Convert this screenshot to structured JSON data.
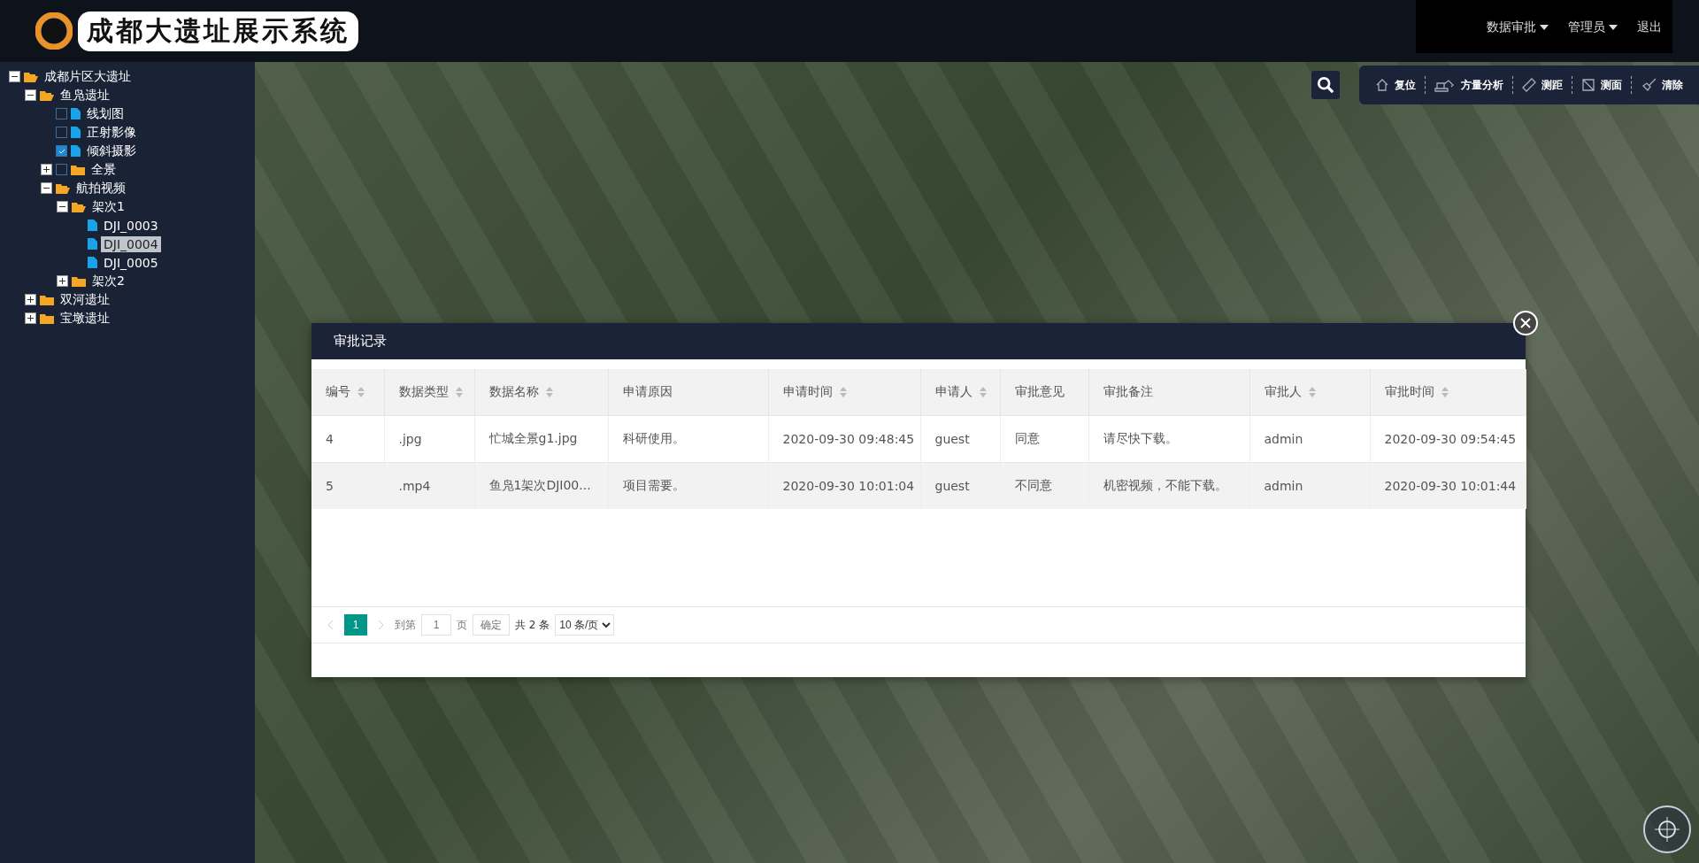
{
  "header": {
    "title": "成都大遗址展示系统",
    "nav": [
      {
        "label": "数据审批",
        "dropdown": true
      },
      {
        "label": "管理员",
        "dropdown": true
      },
      {
        "label": "退出",
        "dropdown": false
      }
    ]
  },
  "tree": [
    {
      "label": "成都片区大遗址",
      "kind": "folder",
      "expanded": true,
      "selected": false,
      "children": [
        {
          "label": "鱼凫遗址",
          "kind": "folder",
          "expanded": true,
          "selected": false,
          "children": [
            {
              "label": "线划图",
              "kind": "file",
              "checked": false,
              "selected": false
            },
            {
              "label": "正射影像",
              "kind": "file",
              "checked": false,
              "selected": false
            },
            {
              "label": "倾斜摄影",
              "kind": "file",
              "checked": true,
              "selected": false
            },
            {
              "label": "全景",
              "kind": "folder",
              "expanded": false,
              "checked": false,
              "selected": false
            },
            {
              "label": "航拍视频",
              "kind": "folder",
              "expanded": true,
              "selected": false,
              "children": [
                {
                  "label": "架次1",
                  "kind": "folder",
                  "expanded": true,
                  "selected": false,
                  "children": [
                    {
                      "label": "DJI_0003",
                      "kind": "file",
                      "selected": false
                    },
                    {
                      "label": "DJI_0004",
                      "kind": "file",
                      "selected": true
                    },
                    {
                      "label": "DJI_0005",
                      "kind": "file",
                      "selected": false
                    }
                  ]
                },
                {
                  "label": "架次2",
                  "kind": "folder",
                  "expanded": false,
                  "selected": false
                }
              ]
            }
          ]
        },
        {
          "label": "双河遗址",
          "kind": "folder",
          "expanded": false,
          "selected": false
        },
        {
          "label": "宝墩遗址",
          "kind": "folder",
          "expanded": false,
          "selected": false
        }
      ]
    }
  ],
  "toolbar": [
    {
      "label": "复位",
      "kind": "home"
    },
    {
      "label": "方量分析",
      "kind": "excavator"
    },
    {
      "label": "测距",
      "kind": "ruler"
    },
    {
      "label": "测面",
      "kind": "area"
    },
    {
      "label": "清除",
      "kind": "brush"
    }
  ],
  "dialog": {
    "title": "审批记录",
    "columns": [
      {
        "label": "编号",
        "sortable": true
      },
      {
        "label": "数据类型",
        "sortable": true
      },
      {
        "label": "数据名称",
        "sortable": true
      },
      {
        "label": "申请原因",
        "sortable": false
      },
      {
        "label": "申请时间",
        "sortable": true
      },
      {
        "label": "申请人",
        "sortable": true
      },
      {
        "label": "审批意见",
        "sortable": false
      },
      {
        "label": "审批备注",
        "sortable": false
      },
      {
        "label": "审批人",
        "sortable": true
      },
      {
        "label": "审批时间",
        "sortable": true
      }
    ],
    "rows": [
      [
        "4",
        ".jpg",
        "忙城全景g1.jpg",
        "科研使用。",
        "2020-09-30 09:48:45",
        "guest",
        "同意",
        "请尽快下载。",
        "admin",
        "2020-09-30 09:54:45"
      ],
      [
        "5",
        ".mp4",
        "鱼凫1架次DJI00...",
        "项目需要。",
        "2020-09-30 10:01:04",
        "guest",
        "不同意",
        "机密视频，不能下载。",
        "admin",
        "2020-09-30 10:01:44"
      ]
    ],
    "pagination": {
      "pages": [
        {
          "label": "1",
          "selected": true
        }
      ],
      "goto_label": "到第",
      "goto_value": "1",
      "page_unit": "页",
      "confirm": "确定",
      "total": "共 2 条",
      "page_size": "10 条/页"
    }
  }
}
